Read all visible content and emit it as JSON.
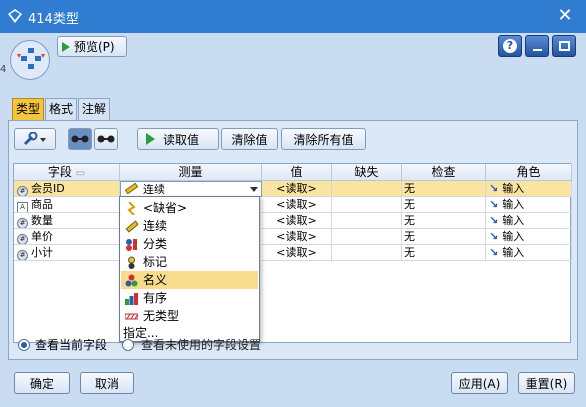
{
  "window": {
    "title": "414类型",
    "close_glyph": "✕"
  },
  "toolbar": {
    "preview_label": "预览(P)",
    "help_label": "?"
  },
  "tabs": [
    {
      "label": "类型",
      "active": true
    },
    {
      "label": "格式",
      "active": false
    },
    {
      "label": "注解",
      "active": false
    }
  ],
  "actions": {
    "read_values": "读取值",
    "clear_values": "清除值",
    "clear_all_values": "清除所有值"
  },
  "table": {
    "columns": [
      "字段",
      "测量",
      "值",
      "缺失",
      "检查",
      "角色"
    ],
    "rows": [
      {
        "field": "会员ID",
        "measure": "连续",
        "value": "<读取>",
        "missing": "",
        "check": "无",
        "role": "输入",
        "icon": "continuous",
        "selected": true
      },
      {
        "field": "商品",
        "measure": "",
        "value": "<读取>",
        "missing": "",
        "check": "无",
        "role": "输入",
        "icon": "string",
        "selected": false
      },
      {
        "field": "数量",
        "measure": "",
        "value": "<读取>",
        "missing": "",
        "check": "无",
        "role": "输入",
        "icon": "continuous",
        "selected": false
      },
      {
        "field": "单价",
        "measure": "",
        "value": "<读取>",
        "missing": "",
        "check": "无",
        "role": "输入",
        "icon": "continuous",
        "selected": false
      },
      {
        "field": "小计",
        "measure": "",
        "value": "<读取>",
        "missing": "",
        "check": "无",
        "role": "输入",
        "icon": "continuous",
        "selected": false
      }
    ]
  },
  "measure_dropdown": {
    "items": [
      {
        "label": "<缺省>",
        "icon": "default-icon"
      },
      {
        "label": "连续",
        "icon": "continuous-icon"
      },
      {
        "label": "分类",
        "icon": "categorical-icon"
      },
      {
        "label": "标记",
        "icon": "flag-icon"
      },
      {
        "label": "名义",
        "icon": "nominal-icon",
        "highlighted": true
      },
      {
        "label": "有序",
        "icon": "ordinal-icon"
      },
      {
        "label": "无类型",
        "icon": "typeless-icon"
      },
      {
        "label": "指定...",
        "icon": ""
      }
    ]
  },
  "view_options": {
    "current_fields": "查看当前字段",
    "unused_fields": "查看未使用的字段设置"
  },
  "footer": {
    "ok": "确定",
    "cancel": "取消",
    "apply": "应用(A)",
    "reset": "重置(R)"
  },
  "colors": {
    "titlebar": "#2f7cd1",
    "panel": "#dbe8f7",
    "selection": "#fbe3a0",
    "highlight": "#f6dc8c",
    "active_tab": "#f5c542"
  }
}
